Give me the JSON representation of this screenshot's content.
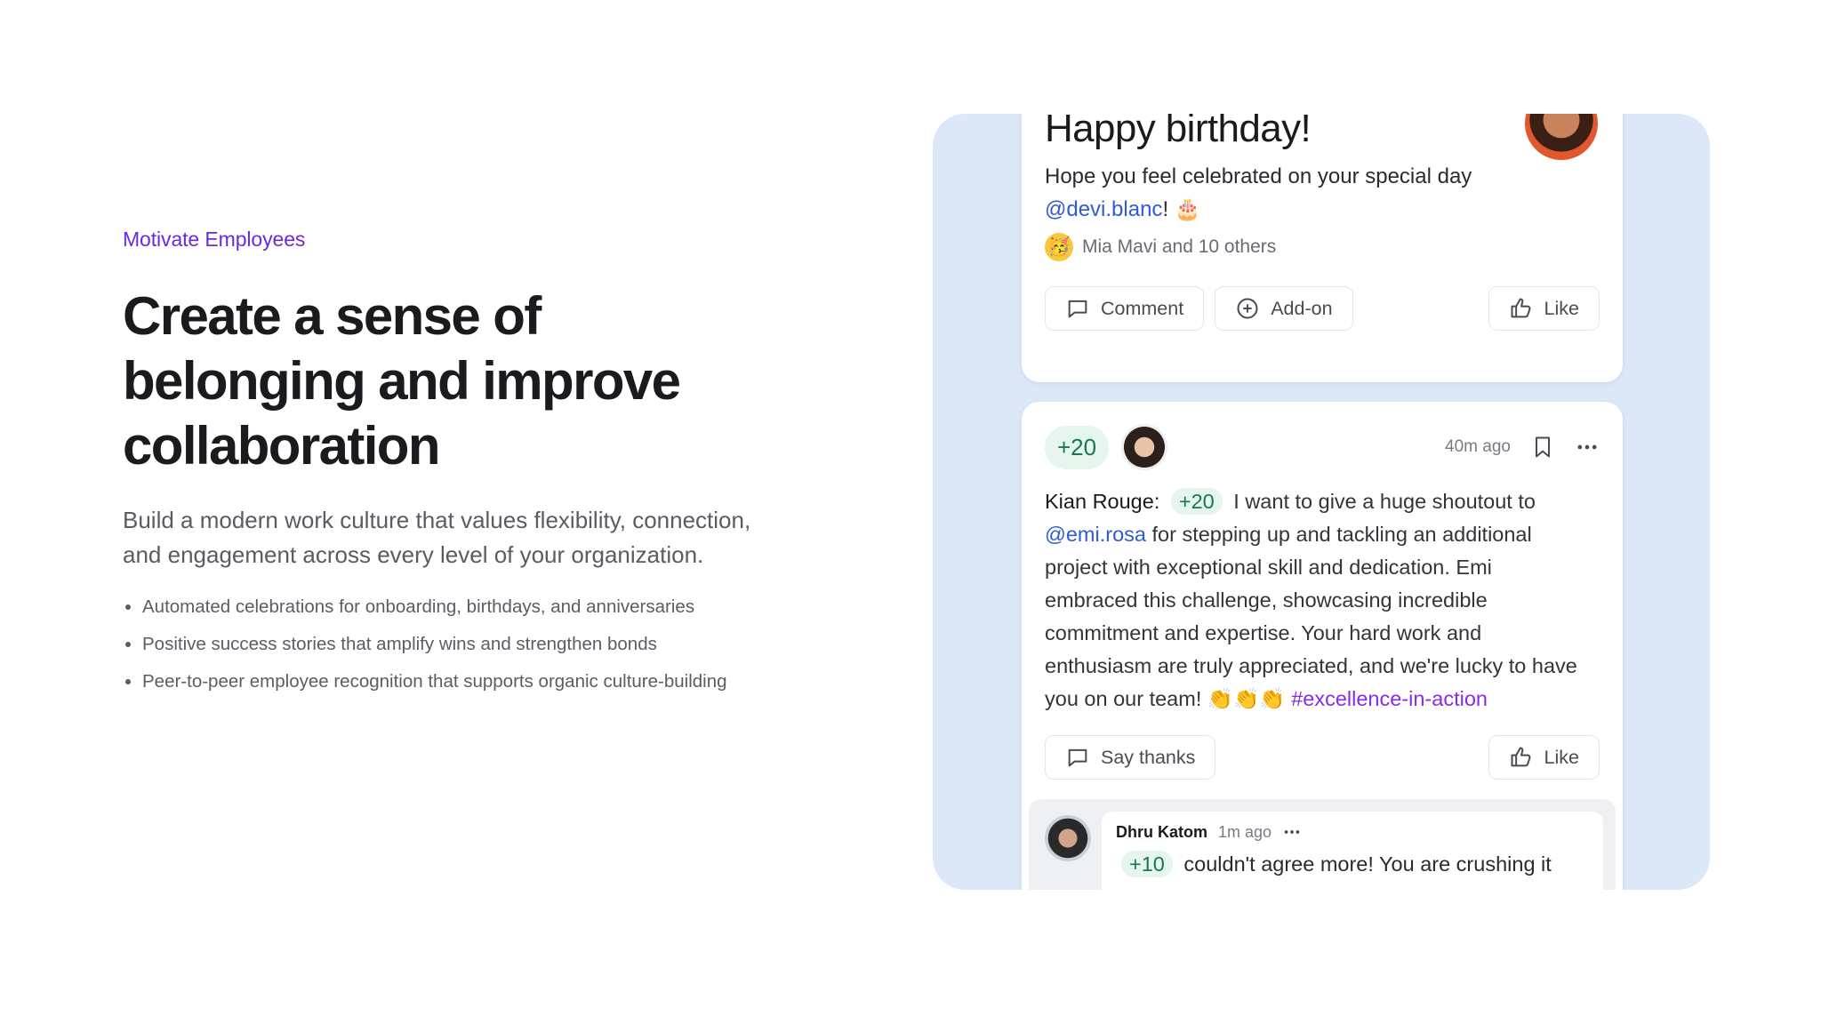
{
  "hero": {
    "eyebrow": "Motivate Employees",
    "headline_line1": "Create a sense of",
    "headline_line2": "belonging and improve",
    "headline_line3": "collaboration",
    "lead": "Build a modern work culture that values flexibility, connection, and engagement across every level of your organization.",
    "bullets": [
      "Automated celebrations for onboarding, birthdays, and anniversaries",
      "Positive success stories that amplify wins and strengthen bonds",
      "Peer-to-peer employee recognition that supports organic culture-building"
    ]
  },
  "birthday_card": {
    "title": "Happy birthday!",
    "message": "Hope you feel celebrated on your special day",
    "mention": "@devi.blanc",
    "mention_suffix": "! 🎂",
    "reactions_text": "Mia Mavi and 10 others",
    "reaction_emoji": "🥳",
    "comment_label": "Comment",
    "addon_label": "Add-on",
    "like_label": "Like"
  },
  "recognition_post": {
    "points": "+20",
    "time": "40m ago",
    "author": "Kian Rouge:",
    "inline_points": "+20",
    "text_before_mention": "I want to give a huge shoutout to",
    "mention": "@emi.rosa",
    "text_after_mention": "for stepping up and tackling an additional project with exceptional skill and dedication. Emi embraced this challenge, showcasing incredible commitment and expertise. Your hard work and enthusiasm are truly appreciated, and we're lucky to have you on our team! 👏👏👏",
    "hashtag": "#excellence-in-action",
    "say_thanks_label": "Say thanks",
    "like_label": "Like"
  },
  "reply": {
    "name": "Dhru Katom",
    "time": "1m ago",
    "points": "+10",
    "text": "couldn't agree more! You are crushing it"
  },
  "colors": {
    "accent_purple": "#6a2be0",
    "panel_bg": "#dce8f7",
    "points_green": "#167a4d",
    "mention_blue": "#2f5bd6"
  }
}
